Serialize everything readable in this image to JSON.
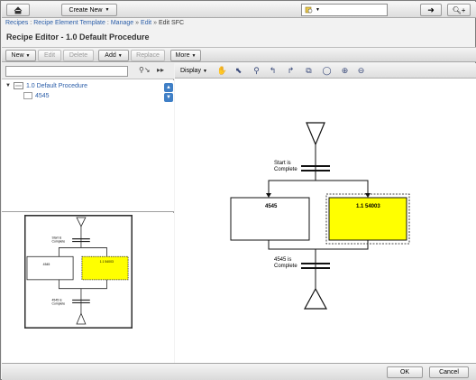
{
  "topbar": {
    "home_icon": "home-icon",
    "create_new_label": "Create New",
    "search_placeholder": "",
    "go_icon": "arrow-right-icon",
    "find_icon": "find-plus-icon"
  },
  "breadcrumb": {
    "items": [
      "Recipes",
      "Recipe Element Template",
      "Manage",
      "Edit",
      "Edit SFC"
    ],
    "separators": [
      ":",
      ":",
      "»",
      "»"
    ]
  },
  "page_title": "Recipe Editor - 1.0 Default Procedure",
  "toolbar": {
    "new_label": "New",
    "edit_label": "Edit",
    "delete_label": "Delete",
    "add_label": "Add",
    "replace_label": "Replace",
    "more_label": "More"
  },
  "tree": {
    "filter_value": "",
    "root_label": "1.0 Default Procedure",
    "child_label": "4545"
  },
  "minimap": {
    "step_left": "4545",
    "step_right": "1.1 54003",
    "trans_top": "Start is Complete",
    "trans_bottom": "4545 is Complete"
  },
  "diagram_toolbar": {
    "display_label": "Display",
    "icons": [
      "hand-icon",
      "pointer-icon",
      "connect-icon",
      "link-left-icon",
      "link-right-icon",
      "node-icon",
      "zoom-fit-icon",
      "zoom-in-icon",
      "zoom-out-icon"
    ]
  },
  "diagram": {
    "trans_top_line1": "Start is",
    "trans_top_line2": "Complete",
    "step_left": "4545",
    "step_right": "1.1 54003",
    "trans_bottom_line1": "4545 is",
    "trans_bottom_line2": "Complete",
    "highlight_color": "#ffff00"
  },
  "footer": {
    "ok_label": "OK",
    "cancel_label": "Cancel"
  }
}
